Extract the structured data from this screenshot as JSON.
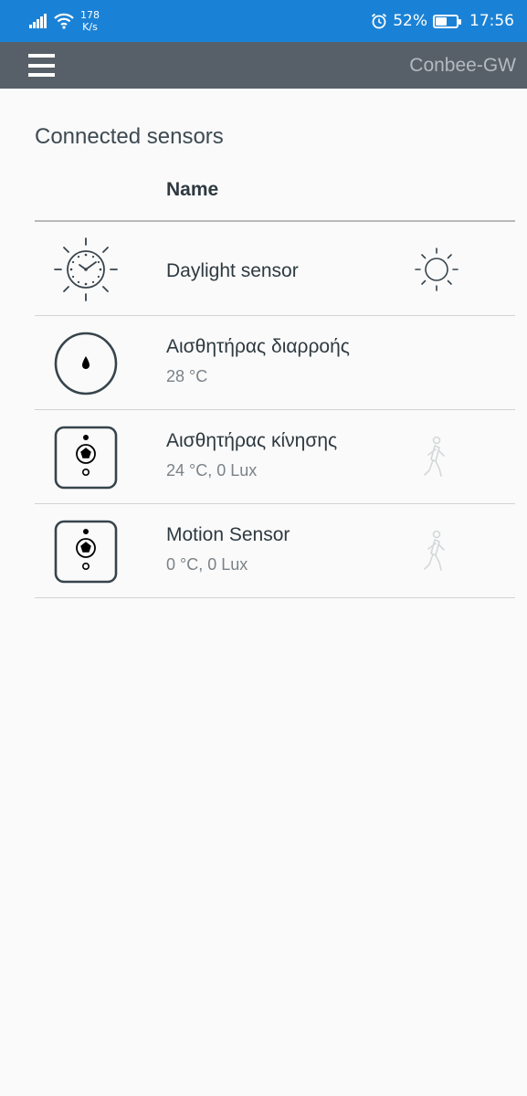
{
  "status_bar": {
    "net_speed_value": "178",
    "net_speed_unit": "K/s",
    "battery": "52%",
    "battery_level": 0.52,
    "time": "17:56",
    "icons": [
      "signal-icon",
      "wifi-icon",
      "alarm-icon",
      "battery-icon"
    ]
  },
  "app_bar": {
    "title": "Conbee-GW",
    "menu_icon": "hamburger-menu-icon"
  },
  "page": {
    "section_title": "Connected sensors",
    "column_name": "Name"
  },
  "sensors": [
    {
      "name": "Daylight sensor",
      "sub": "",
      "icon": "daylight-clock-icon",
      "state_icon": "sun-icon"
    },
    {
      "name": "Αισθητήρας διαρροής",
      "sub": "28 °C",
      "icon": "water-leak-icon",
      "state_icon": ""
    },
    {
      "name": "Αισθητήρας κίνησης",
      "sub": "24 °C, 0 Lux",
      "icon": "motion-sensor-icon",
      "state_icon": "walking-person-icon"
    },
    {
      "name": "Motion Sensor",
      "sub": "0 °C, 0 Lux",
      "icon": "motion-sensor-icon",
      "state_icon": "walking-person-icon"
    }
  ],
  "colors": {
    "status_bar": "#1a82d6",
    "app_bar": "#576068",
    "icon_stroke": "#37444c",
    "inactive_icon": "#d4d8da"
  }
}
